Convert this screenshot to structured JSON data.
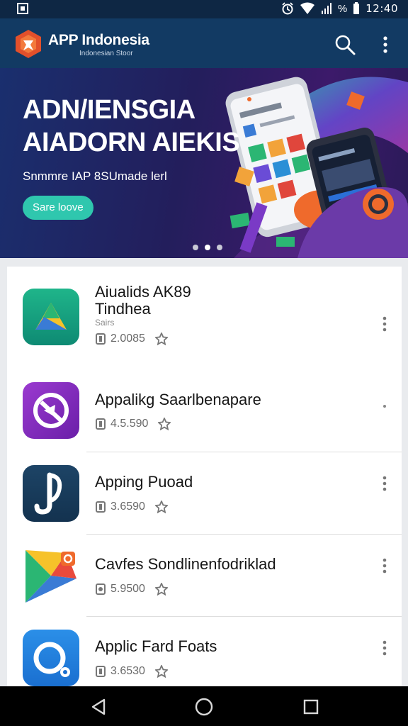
{
  "status_bar": {
    "time": "12:40",
    "battery": "%",
    "icons": [
      "screenshot-icon",
      "alarm-icon",
      "wifi-icon",
      "signal-icon",
      "battery-icon"
    ]
  },
  "app_bar": {
    "title": "APP Indonesia",
    "subtitle": "Indonesian Stoor",
    "icons": [
      "app-logo",
      "search-icon",
      "more-vert-icon"
    ]
  },
  "banner": {
    "headline_line1": "ADN/IENSGIA",
    "headline_line2": "AIADORN AIEKIS",
    "subtitle": "Snmmre IAP 8SUmade lerl",
    "cta_label": "Sare loove",
    "slides": 3,
    "active_slide": 1,
    "accent_color": "#2fc7ae"
  },
  "apps": [
    {
      "name": "Aiualids AK89\nTindhea",
      "developer": "Sairs",
      "count": "2.0085",
      "icon": "drive-triangle-icon"
    },
    {
      "name": "Appalikg Saarlbenapare",
      "count": "4.5.590",
      "icon": "purple-circle-icon"
    },
    {
      "name": "Apping Puoad",
      "count": "3.6590",
      "icon": "music-note-icon"
    },
    {
      "name": "Cavfes Sondlinenfodriklad",
      "count": "5.9500",
      "icon": "play-triangle-icon"
    },
    {
      "name": "Applic Fard Foats",
      "count": "3.6530",
      "icon": "blue-ring-icon"
    }
  ],
  "nav_bar": {
    "icons": [
      "back-icon",
      "home-icon",
      "recents-icon"
    ]
  }
}
